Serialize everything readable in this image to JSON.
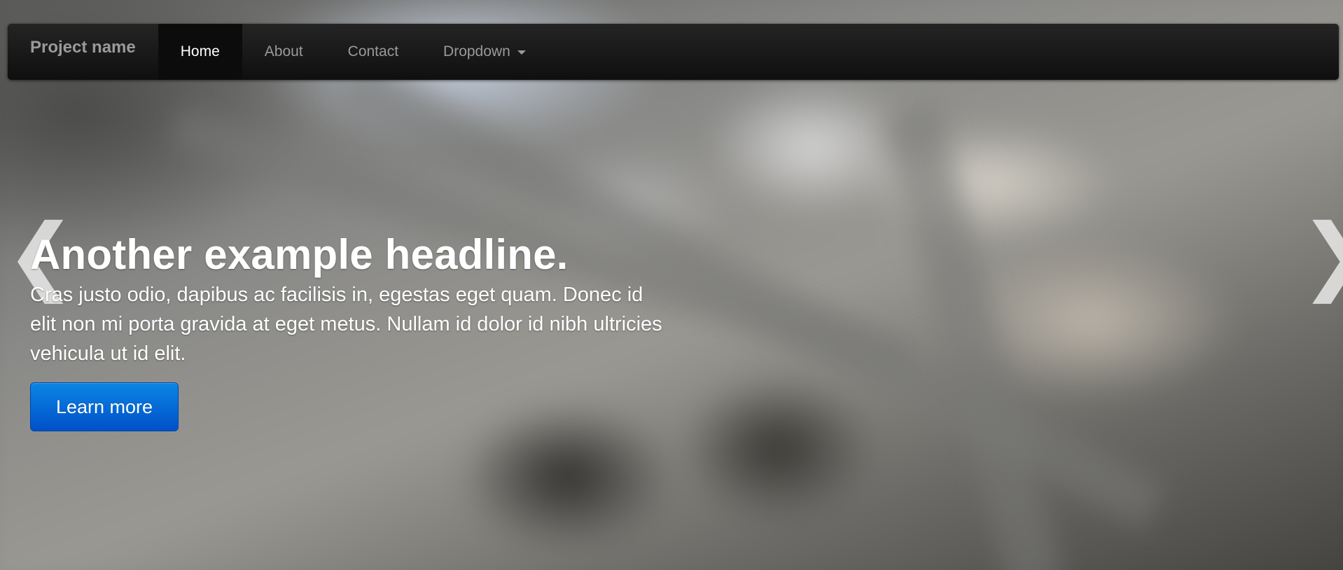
{
  "navbar": {
    "brand": "Project name",
    "items": [
      {
        "label": "Home",
        "active": true
      },
      {
        "label": "About",
        "active": false
      },
      {
        "label": "Contact",
        "active": false
      },
      {
        "label": "Dropdown",
        "active": false,
        "has_caret": true
      }
    ]
  },
  "carousel": {
    "headline": "Another example headline.",
    "lead": "Cras justo odio, dapibus ac facilisis in, egestas eget quam. Donec id elit non mi porta gravida at eget metus. Nullam id dolor id nibh ultricies vehicula ut id elit.",
    "button_label": "Learn more",
    "prev_glyph": "❮",
    "next_glyph": "❯"
  },
  "colors": {
    "navbar_bg": "#1b1b1b",
    "nav_text": "#9a9a9a",
    "nav_active_text": "#ffffff",
    "button_primary": "#0066d6"
  }
}
